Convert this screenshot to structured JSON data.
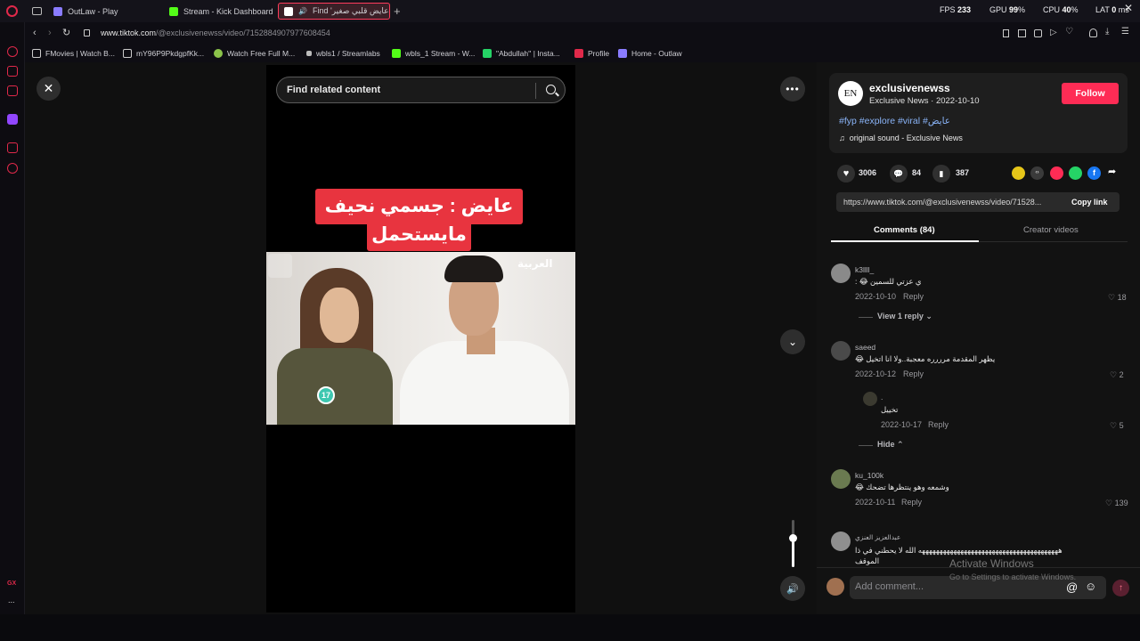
{
  "browser": {
    "tabs": [
      {
        "label": "OutLaw - Play",
        "color": "#8a7cff"
      },
      {
        "label": "Stream - Kick Dashboard",
        "color": "#53fc18"
      },
      {
        "label": "Find 'عايض قلبي صغير",
        "color": "#ff3b5c"
      }
    ],
    "hud": {
      "fps_label": "FPS",
      "fps": "233",
      "gpu_label": "GPU",
      "gpu": "99",
      "cpu_label": "CPU",
      "cpu": "40",
      "lat_label": "LAT",
      "lat": "0",
      "percent": "%",
      "ms": "ms"
    },
    "address": {
      "host": "www.tiktok.com",
      "path": "/@exclusivenewss/video/7152884907977608454"
    },
    "bookmarks": [
      {
        "label": "FMovies | Watch B...",
        "color": "#e8e8e8"
      },
      {
        "label": "mY96P9PkdgpfKk...",
        "color": "#e8e8e8"
      },
      {
        "label": "Watch Free Full M...",
        "color": "#8bc34a"
      },
      {
        "label": "wbls1 / Streamlabs",
        "color": "#bbbbbb"
      },
      {
        "label": "wbls_1 Stream - W...",
        "color": "#53fc18"
      },
      {
        "label": "\"Abdullah'' | Insta...",
        "color": "#25d366"
      },
      {
        "label": "Profile",
        "color": "#e0294a"
      },
      {
        "label": "Home - Outlaw",
        "color": "#8a7cff"
      }
    ],
    "sidebar_gx": "GX",
    "sidebar_more": "...",
    "accent": "#ff3b5c"
  },
  "video": {
    "search_placeholder": "Find related content",
    "caption_line1": "عايض : جسمي نحيف",
    "caption_line2": "مايستحمل",
    "channel_logo": "العربية",
    "badge": "17"
  },
  "post": {
    "avatar": "EN",
    "username": "exclusivenewss",
    "subtitle": "Exclusive  News · 2022-10-10",
    "follow": "Follow",
    "hashtags": "#fyp #explore #viral #عايض",
    "sound": "original sound - Exclusive  News",
    "likes": "3006",
    "comments_count": "84",
    "saves": "387",
    "link": "https://www.tiktok.com/@exclusivenewss/video/71528...",
    "copy_link": "Copy link",
    "tab_comments": "Comments (84)",
    "tab_creator": "Creator videos",
    "follow_color": "#fe2c55"
  },
  "comments": [
    {
      "name": "k3llll_",
      "text": "ي عزتي للسمين 😂 :",
      "date": "2022-10-10",
      "reply": "Reply",
      "likes": "18",
      "view_replies": "View 1 reply"
    },
    {
      "name": "saeed",
      "text": "يظهر المقدمة مرررره معجبة..ولا انا اتخيل 😂",
      "date": "2022-10-12",
      "reply": "Reply",
      "likes": "2",
      "hide": "Hide"
    },
    {
      "name": ".",
      "text": "تخييل",
      "date": "2022-10-17",
      "reply": "Reply",
      "likes": "5"
    },
    {
      "name": "ku_100k",
      "text": "وشمعه وهو ينتظرها تضحك 😂",
      "date": "2022-10-11",
      "reply": "Reply",
      "likes": "139"
    },
    {
      "name": "عبدالعزيز العنزي",
      "text": "ههههههههههههههههههههههههههههههههههههههههه الله لا يحطني في ذا",
      "text2": "الموقف"
    }
  ],
  "composer": {
    "placeholder": "Add comment...",
    "at": "@"
  },
  "watermark": {
    "line1": "Activate Windows",
    "line2": "Go to Settings to activate Windows."
  }
}
